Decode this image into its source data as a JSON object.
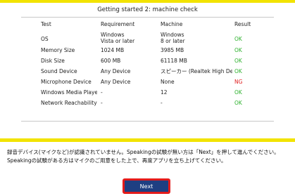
{
  "title": "Getting started 2: machine check",
  "table": {
    "headers": [
      "Test",
      "Requirement",
      "Machine",
      "Result"
    ],
    "rows": [
      {
        "test": "OS",
        "requirement_line1": "Windows",
        "requirement_line2": "Vista or later",
        "machine_line1": "Windows",
        "machine_line2": "8 or later",
        "result": "OK"
      },
      {
        "test": "Memory Size",
        "requirement": "1024 MB",
        "machine": "3985 MB",
        "result": "OK"
      },
      {
        "test": "Disk Size",
        "requirement": "600 MB",
        "machine": "61118 MB",
        "result": "OK"
      },
      {
        "test": "Sound Device",
        "requirement": "Any Device",
        "machine": "スピーカー (Realtek High Defir",
        "result": "OK"
      },
      {
        "test": "Microphone Device",
        "requirement": "Any Device",
        "machine": "None",
        "result": "NG"
      },
      {
        "test": "Windows Media Player",
        "requirement": "-",
        "machine": "12",
        "result": "OK"
      },
      {
        "test": "Network Reachability",
        "requirement": "-",
        "machine": "-",
        "result": "OK"
      }
    ]
  },
  "message": {
    "line1": "録音デバイス(マイクなど)が認識されていません。Speakingの試験が無い方は「Next」を押して進んでください。",
    "line2": "Speakingの試験がある方はマイクのご用意をした上で、再度アプリを立ち上げてください。"
  },
  "next_label": "Next",
  "colors": {
    "ok": "#2db12d",
    "ng": "#e02020",
    "frame": "#f2e300",
    "button": "#1e3f82",
    "highlight": "#e31b1b"
  }
}
